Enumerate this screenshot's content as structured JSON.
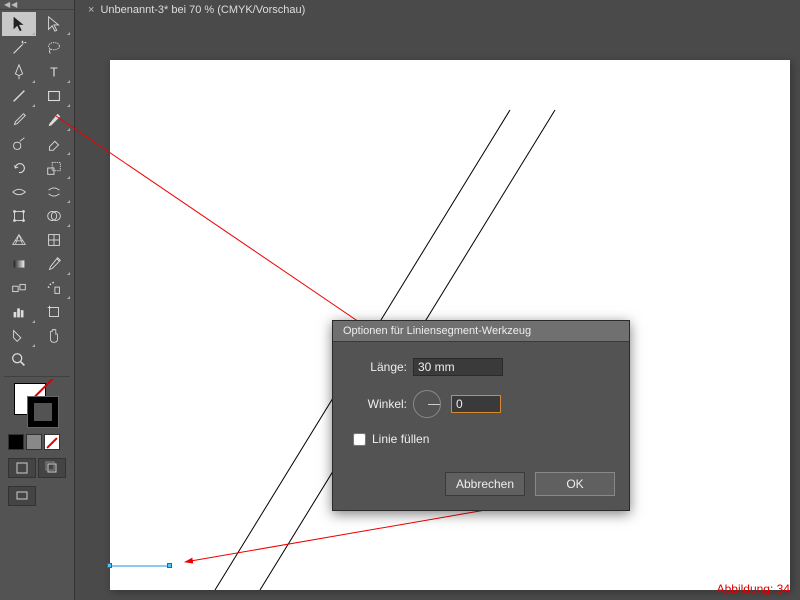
{
  "tab": {
    "title": "Unbenannt-3* bei 70 % (CMYK/Vorschau)"
  },
  "dialog": {
    "title": "Optionen für Liniensegment-Werkzeug",
    "length_label": "Länge:",
    "length_value": "30 mm",
    "angle_label": "Winkel:",
    "angle_value": "0",
    "fill_label": "Linie füllen",
    "cancel": "Abbrechen",
    "ok": "OK"
  },
  "figure_label": "Abbildung: 34",
  "tools": [
    "selection",
    "direct-selection",
    "magic-wand",
    "lasso",
    "pen",
    "type",
    "line-segment",
    "rectangle",
    "paintbrush",
    "pencil",
    "blob-brush",
    "eraser",
    "rotate",
    "scale",
    "width",
    "warp",
    "free-transform",
    "shape-builder",
    "perspective-grid",
    "mesh",
    "gradient",
    "eyedropper",
    "blend",
    "symbol-sprayer",
    "column-graph",
    "artboard",
    "slice",
    "hand",
    "zoom"
  ]
}
